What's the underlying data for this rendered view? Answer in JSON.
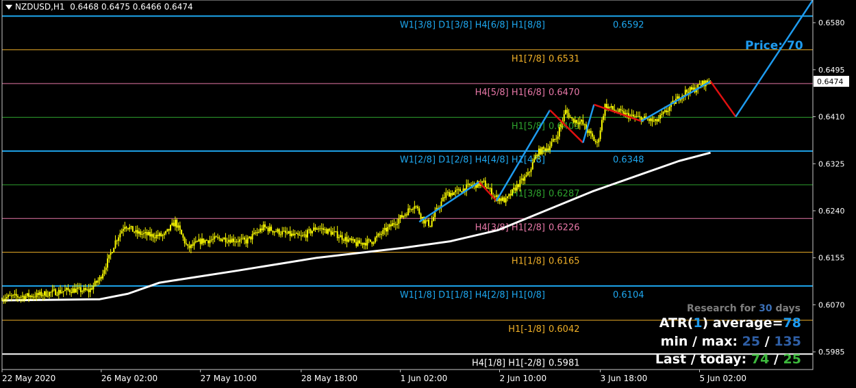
{
  "header": {
    "symbol": "NZDUSD,H1",
    "ohlc": "0.6468 0.6475 0.6466 0.6474"
  },
  "price_label": {
    "label": "Price:",
    "value": "70"
  },
  "stats": {
    "research_prefix": "Research for",
    "research_days": "30",
    "research_suffix": "days",
    "atr_prefix": "ATR(",
    "atr_period": "1",
    "atr_mid": ") average=",
    "atr_value": "78",
    "minmax_label": "min / max:",
    "min": "25",
    "sep": "/",
    "max": "135",
    "last_label": "Last / today:",
    "last": "74",
    "today": "25"
  },
  "colors": {
    "background": "#000000",
    "candle": "#ffff00",
    "ma": "#ffffff",
    "zigzag_up": "#1e9bef",
    "zigzag_down": "#e01010",
    "level_blue": "#1ea8f0",
    "level_orange": "#f0b028",
    "level_green": "#2ea42e",
    "level_pink": "#e878a8",
    "level_white": "#ffffff"
  },
  "chart_data": {
    "type": "candlestick",
    "symbol": "NZDUSD",
    "timeframe": "H1",
    "ylim": [
      0.5953,
      0.6621
    ],
    "y_ticks": [
      "0.6580",
      "0.6495",
      "0.6410",
      "0.6325",
      "0.6240",
      "0.6155",
      "0.6070",
      "0.5985"
    ],
    "y_tick_values": [
      0.658,
      0.6495,
      0.641,
      0.6325,
      0.624,
      0.6155,
      0.607,
      0.5985
    ],
    "x_ticks": [
      "22 May 2020",
      "26 May 02:00",
      "27 May 10:00",
      "28 May 18:00",
      "1 Jun 02:00",
      "2 Jun 10:00",
      "3 Jun 18:00",
      "5 Jun 02:00"
    ],
    "current_price": "0.6474",
    "current_price_value": 0.6474,
    "murrey_levels": [
      {
        "price": 0.6592,
        "label": "W1[3/8] D1[3/8] H4[6/8] H1[8/8]",
        "value": "0.6592",
        "color": "blue"
      },
      {
        "price": 0.6531,
        "label": "H1[7/8]",
        "value": "0.6531",
        "color": "orange"
      },
      {
        "price": 0.647,
        "label": "H4[5/8] H1[6/8]",
        "value": "0.6470",
        "color": "pink"
      },
      {
        "price": 0.6409,
        "label": "H1[5/8]",
        "value": "0.6409",
        "color": "green"
      },
      {
        "price": 0.6348,
        "label": "W1[2/8] D1[2/8] H4[4/8] H1[4/8]",
        "value": "0.6348",
        "color": "blue"
      },
      {
        "price": 0.6287,
        "label": "H1[3/8]",
        "value": "0.6287",
        "color": "green"
      },
      {
        "price": 0.6226,
        "label": "H4[3/8] H1[2/8]",
        "value": "0.6226",
        "color": "pink"
      },
      {
        "price": 0.6165,
        "label": "H1[1/8]",
        "value": "0.6165",
        "color": "orange"
      },
      {
        "price": 0.6104,
        "label": "W1[1/8] D1[1/8] H4[2/8] H1[0/8]",
        "value": "0.6104",
        "color": "blue"
      },
      {
        "price": 0.6042,
        "label": "H1[-1/8]",
        "value": "0.6042",
        "color": "orange"
      },
      {
        "price": 0.5981,
        "label": "H4[1/8] H1[-2/8]",
        "value": "0.5981",
        "color": "white"
      }
    ],
    "price_anchors": [
      [
        0,
        0.6083
      ],
      [
        10,
        0.6085
      ],
      [
        22,
        0.6087
      ],
      [
        33,
        0.6093
      ],
      [
        45,
        0.6097
      ],
      [
        55,
        0.6095
      ],
      [
        62,
        0.6117
      ],
      [
        68,
        0.6155
      ],
      [
        72,
        0.6185
      ],
      [
        78,
        0.6215
      ],
      [
        85,
        0.62
      ],
      [
        95,
        0.6195
      ],
      [
        103,
        0.6195
      ],
      [
        110,
        0.622
      ],
      [
        118,
        0.6172
      ],
      [
        126,
        0.6185
      ],
      [
        140,
        0.619
      ],
      [
        155,
        0.6185
      ],
      [
        166,
        0.621
      ],
      [
        178,
        0.62
      ],
      [
        190,
        0.6192
      ],
      [
        200,
        0.621
      ],
      [
        210,
        0.62
      ],
      [
        225,
        0.618
      ],
      [
        235,
        0.6185
      ],
      [
        245,
        0.6208
      ],
      [
        255,
        0.6232
      ],
      [
        262,
        0.6252
      ],
      [
        268,
        0.6222
      ],
      [
        272,
        0.6215
      ],
      [
        275,
        0.6235
      ],
      [
        282,
        0.627
      ],
      [
        290,
        0.6275
      ],
      [
        297,
        0.6285
      ],
      [
        306,
        0.629
      ],
      [
        313,
        0.6265
      ],
      [
        320,
        0.6258
      ],
      [
        327,
        0.6285
      ],
      [
        334,
        0.6305
      ],
      [
        340,
        0.6345
      ],
      [
        347,
        0.6355
      ],
      [
        352,
        0.6372
      ],
      [
        358,
        0.642
      ],
      [
        362,
        0.6405
      ],
      [
        368,
        0.64
      ],
      [
        373,
        0.638
      ],
      [
        378,
        0.636
      ],
      [
        383,
        0.643
      ],
      [
        390,
        0.642
      ],
      [
        400,
        0.641
      ],
      [
        410,
        0.6405
      ],
      [
        415,
        0.64
      ],
      [
        422,
        0.642
      ],
      [
        428,
        0.644
      ],
      [
        434,
        0.6455
      ],
      [
        440,
        0.646
      ],
      [
        445,
        0.647
      ],
      [
        450,
        0.6474
      ]
    ],
    "candle_count": 451,
    "ma_points": [
      [
        0,
        0.6078
      ],
      [
        62,
        0.608
      ],
      [
        80,
        0.609
      ],
      [
        100,
        0.611
      ],
      [
        150,
        0.6132
      ],
      [
        200,
        0.6155
      ],
      [
        255,
        0.6173
      ],
      [
        285,
        0.6185
      ],
      [
        315,
        0.6205
      ],
      [
        345,
        0.624
      ],
      [
        375,
        0.6275
      ],
      [
        405,
        0.6305
      ],
      [
        430,
        0.633
      ],
      [
        450,
        0.6345
      ]
    ],
    "zigzag": [
      {
        "x": 265,
        "price": 0.622,
        "swing": "low"
      },
      {
        "x": 303,
        "price": 0.6292,
        "swing": "high"
      },
      {
        "x": 314,
        "price": 0.6258,
        "swing": "low"
      },
      {
        "x": 348,
        "price": 0.6422,
        "swing": "high"
      },
      {
        "x": 369,
        "price": 0.6363,
        "swing": "low"
      },
      {
        "x": 376,
        "price": 0.6432,
        "swing": "high"
      },
      {
        "x": 406,
        "price": 0.6402,
        "swing": "low"
      },
      {
        "x": 450,
        "price": 0.6474,
        "swing": "high"
      },
      {
        "x": 466,
        "price": 0.641,
        "swing": "low"
      },
      {
        "x": 515,
        "price": 0.6621,
        "swing": "high"
      }
    ],
    "zigzag_red_segments": [
      [
        0,
        1
      ],
      [
        2,
        3
      ],
      [
        4,
        5
      ],
      [
        6,
        7
      ],
      [
        8,
        9
      ]
    ]
  }
}
